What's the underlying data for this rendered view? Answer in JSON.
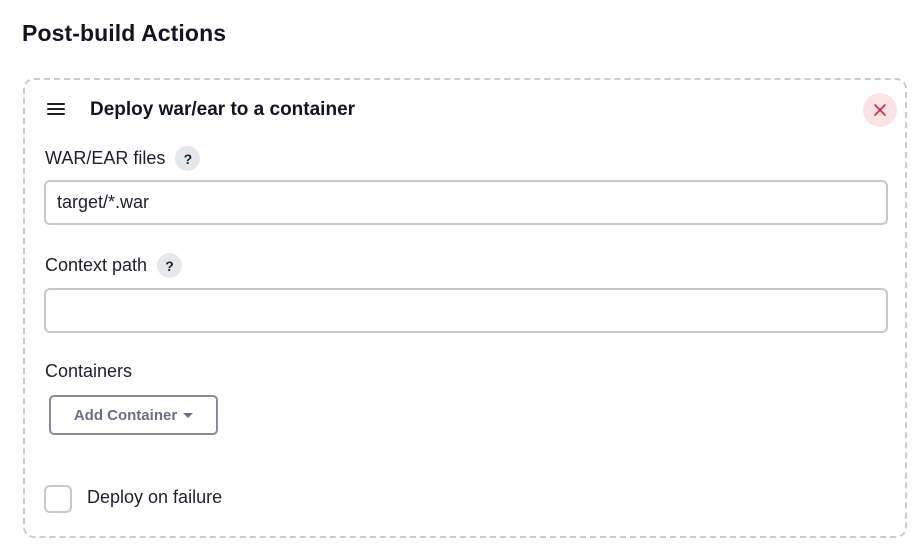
{
  "section": {
    "title": "Post-build Actions"
  },
  "card": {
    "title": "Deploy war/ear to a container",
    "drag_icon": "hamburger-drag-icon",
    "close_icon": "close-icon",
    "close_color": "#d3243a",
    "close_bg": "#fbe3e5"
  },
  "fields": {
    "war_files": {
      "label": "WAR/EAR files",
      "help": "?",
      "value": "target/*.war"
    },
    "context_path": {
      "label": "Context path",
      "help": "?",
      "value": ""
    }
  },
  "containers": {
    "label": "Containers",
    "add_button": "Add Container"
  },
  "deploy_on_failure": {
    "label": "Deploy on failure",
    "checked": false
  }
}
